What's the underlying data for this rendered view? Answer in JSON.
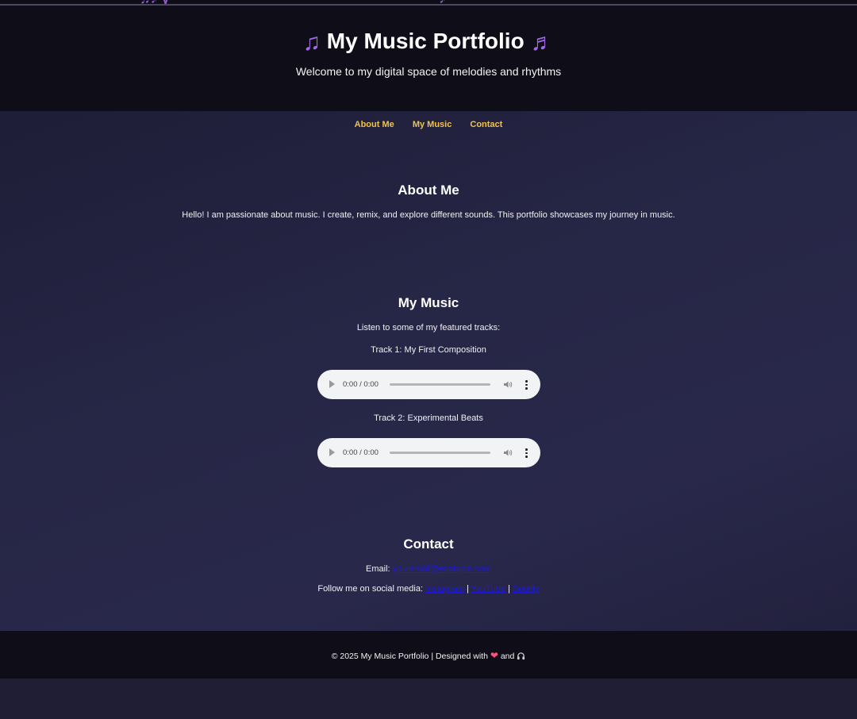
{
  "header": {
    "title": "My Music Portfolio",
    "title_icon_left": "musical-note-icon",
    "title_icon_right": "musical-notes-icon",
    "subtitle": "Welcome to my digital space of melodies and rhythms"
  },
  "nav": {
    "items": [
      {
        "label": "About Me"
      },
      {
        "label": "My Music"
      },
      {
        "label": "Contact"
      }
    ]
  },
  "about": {
    "heading": "About Me",
    "text": "Hello! I am passionate about music. I create, remix, and explore different sounds. This portfolio showcases my journey in music."
  },
  "music": {
    "heading": "My Music",
    "intro": "Listen to some of my featured tracks:",
    "tracks": [
      {
        "title": "Track 1: My First Composition",
        "time": "0:00 / 0:00"
      },
      {
        "title": "Track 2: Experimental Beats",
        "time": "0:00 / 0:00"
      }
    ]
  },
  "contact": {
    "heading": "Contact",
    "email_label": "Email: ",
    "email": "youremail@example.com",
    "social_label": "Follow me on social media: ",
    "social_links": [
      "Instagram",
      "YouTube",
      "Spotify"
    ],
    "separator": " | "
  },
  "footer": {
    "text": "© 2025 My Music Portfolio | Designed with",
    "and": "and",
    "icons": [
      "heart-icon",
      "headphone-icon"
    ]
  },
  "colors": {
    "accent": "#f3c246",
    "header_bg": "#0f0e18",
    "link": "#1e1ad4",
    "note": "#a069e6"
  }
}
